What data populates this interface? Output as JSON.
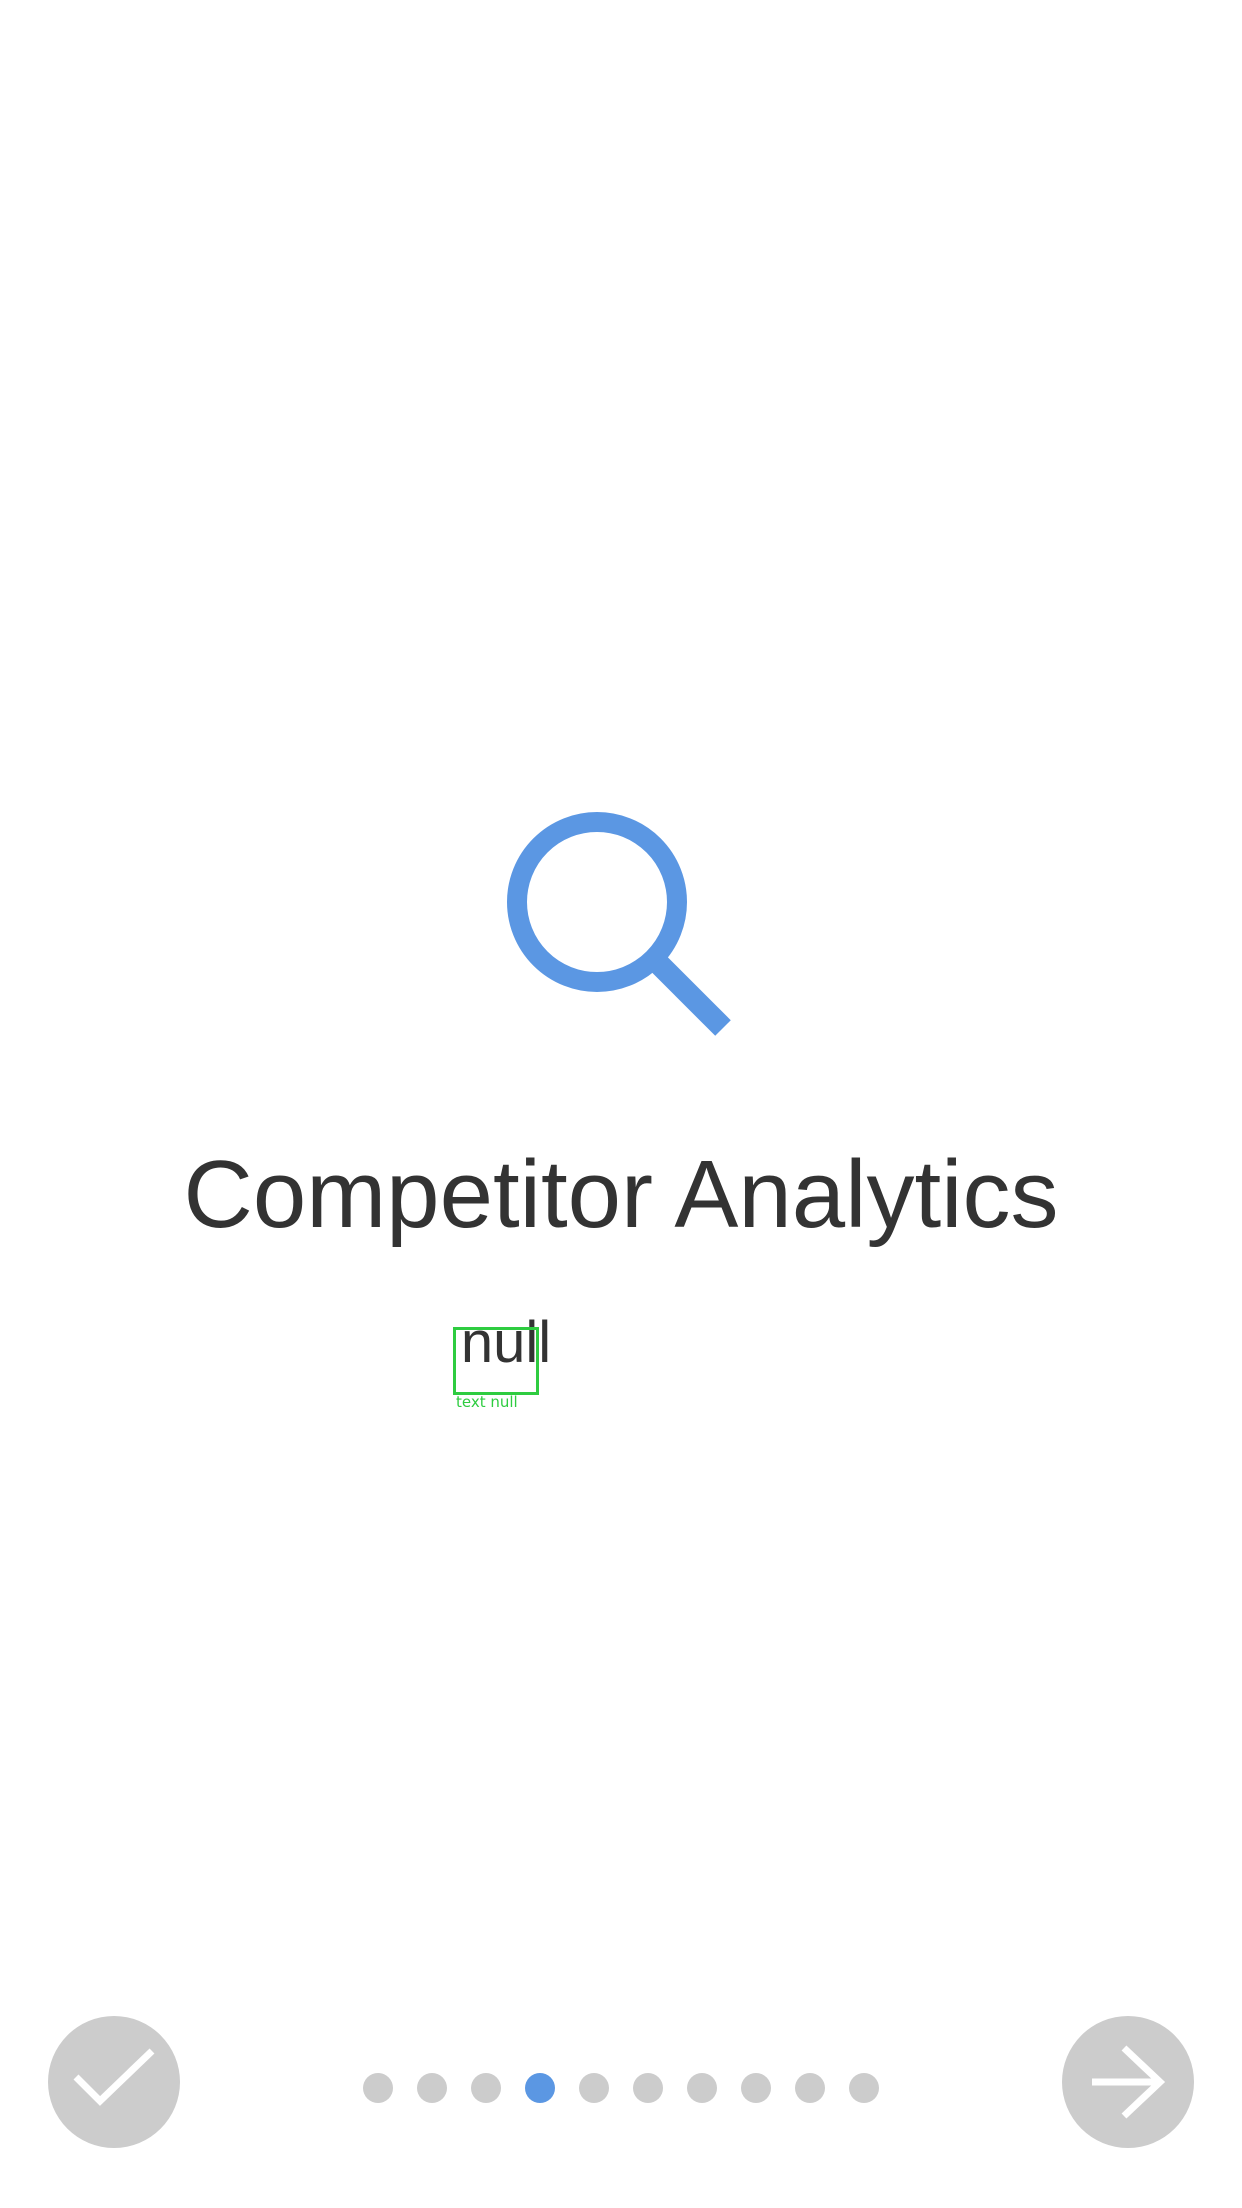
{
  "page": {
    "title": "Competitor Analytics",
    "subtitle": "null",
    "debug_label": "text null"
  },
  "icons": {
    "hero": "search-icon",
    "done_button": "checkmark-icon",
    "next_button": "arrow-right-icon"
  },
  "pagination": {
    "total_pages": 10,
    "current_page": 4
  },
  "colors": {
    "accent": "#5b97e3",
    "text": "#333333",
    "inactive": "#cccccc",
    "debug_overlay": "#2ecc40"
  }
}
